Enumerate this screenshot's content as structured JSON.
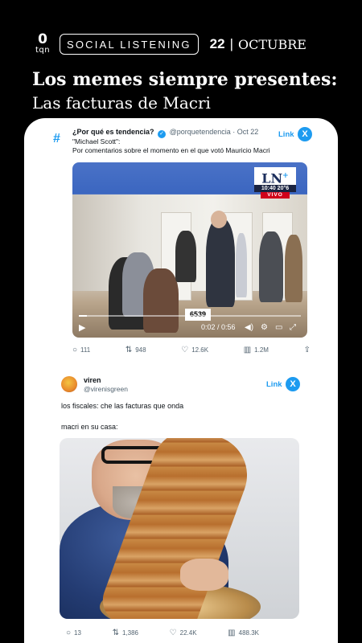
{
  "header": {
    "logo_top": "0",
    "logo_bottom": "tqn",
    "section": "SOCIAL LISTENING",
    "day": "22",
    "separator": "|",
    "month": "OCTUBRE",
    "title": "Los memes siempre presentes:",
    "subtitle": "Las facturas de Macri"
  },
  "tweet1": {
    "hash": "#",
    "name": "¿Por qué es tendencia?",
    "verified": "✓",
    "handle": "@porquetendencia",
    "dot": "·",
    "date": "Oct 22",
    "line1": "\"Michael Scott\":",
    "line2": "Por comentarios sobre el momento en el que votó Mauricio Macri",
    "link": "Link",
    "x": "X",
    "video": {
      "channel": "LN",
      "channel_plus": "+",
      "time": "10:40  20°6",
      "live": "VIVO",
      "sign": "6539",
      "progress": 0.035,
      "timecode": "0:02 / 0:56"
    },
    "actions": {
      "replies": "111",
      "retweets": "948",
      "likes": "12.6K",
      "views": "1.2M"
    }
  },
  "tweet2": {
    "name": "viren",
    "handle": "@virenisgreen",
    "link": "Link",
    "x": "X",
    "line1": "los fiscales: che las facturas que onda",
    "line2": "macri en su casa:",
    "actions": {
      "replies": "13",
      "retweets": "1,386",
      "likes": "22.4K",
      "views": "488.3K"
    }
  },
  "icons": {
    "reply": "○",
    "retweet": "⇅",
    "like": "♡",
    "views": "▥",
    "share": "⇪",
    "play": "▶",
    "volume": "◀)",
    "settings": "⚙",
    "captions": "▭",
    "pip": "⧉",
    "fullscreen": "⤢"
  },
  "colors": {
    "background": "#000000",
    "card": "#ffffff",
    "accent": "#1d9bf0",
    "live_red": "#d0021b"
  }
}
